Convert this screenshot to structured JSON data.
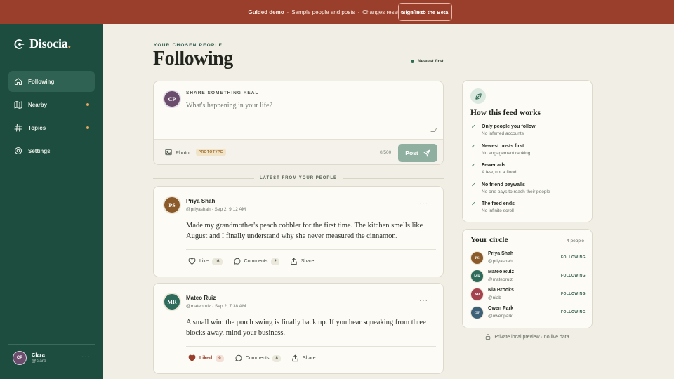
{
  "banner": {
    "title": "Guided demo",
    "parts": [
      "Sample people and posts",
      "Changes reset on refresh"
    ],
    "button": "Sign in to the Beta"
  },
  "sidebar": {
    "brand": "Disocia",
    "items": [
      {
        "label": "Following",
        "icon": "home-icon",
        "active": true
      },
      {
        "label": "Nearby",
        "icon": "map-icon"
      },
      {
        "label": "Topics",
        "icon": "hash-icon"
      },
      {
        "label": "Settings",
        "icon": "gear-icon"
      }
    ],
    "user": {
      "initials": "CP",
      "name": "Clara",
      "handle": "@clara"
    }
  },
  "header": {
    "eyebrow": "YOUR CHOSEN PEOPLE",
    "title": "Following",
    "sort": "Newest first"
  },
  "composer": {
    "initials": "CP",
    "label": "SHARE SOMETHING REAL",
    "placeholder": "What's happening in your life?",
    "photo": "Photo",
    "badge": "PROTOTYPE",
    "count": "0/500",
    "post": "Post"
  },
  "feed_label": "LATEST FROM YOUR PEOPLE",
  "posts": [
    {
      "initials": "PS",
      "name": "Priya Shah",
      "meta": "@priyashah · Sep 2, 9:12 AM",
      "body": "Made my grandmother's peach cobbler for the first time. The kitchen smells like August and I finally understand why she never measured the cinnamon.",
      "like_label": "Like",
      "likes": "16",
      "comments_label": "Comments",
      "comments": "2",
      "share": "Share"
    },
    {
      "initials": "MR",
      "name": "Mateo Ruiz",
      "meta": "@mateoruiz · Sep 2, 7:38 AM",
      "body": "A small win: the porch swing is finally back up. If you hear squeaking from three blocks away, mind your business.",
      "like_label": "Liked",
      "likes": "9",
      "comments_label": "Comments",
      "comments": "8",
      "share": "Share"
    }
  ],
  "how": {
    "title": "How this feed works",
    "items": [
      {
        "t": "Only people you follow",
        "s": "No inferred accounts"
      },
      {
        "t": "Newest posts first",
        "s": "No engagement ranking"
      },
      {
        "t": "Fewer ads",
        "s": "A few, not a flood"
      },
      {
        "t": "No friend paywalls",
        "s": "No one pays to reach their people"
      },
      {
        "t": "The feed ends",
        "s": "No infinite scroll"
      }
    ]
  },
  "circle": {
    "title": "Your circle",
    "count": "4 people",
    "people": [
      {
        "initials": "PS",
        "name": "Priya Shah",
        "handle": "@priyashah",
        "status": "FOLLOWING",
        "color": "#8b5a2b"
      },
      {
        "initials": "MR",
        "name": "Mateo Ruiz",
        "handle": "@mateoruiz",
        "status": "FOLLOWING",
        "color": "#2e6b5a"
      },
      {
        "initials": "NB",
        "name": "Nia Brooks",
        "handle": "@niab",
        "status": "FOLLOWING",
        "color": "#a4424e"
      },
      {
        "initials": "OP",
        "name": "Owen Park",
        "handle": "@owenpark",
        "status": "FOLLOWING",
        "color": "#3d6079"
      }
    ]
  },
  "privacy": "Private local preview · no live data",
  "colors": {
    "banner": "#9a3f2c",
    "sidebar": "#1d4d3f",
    "accent": "#2e6b52",
    "background": "#f1efe5"
  }
}
